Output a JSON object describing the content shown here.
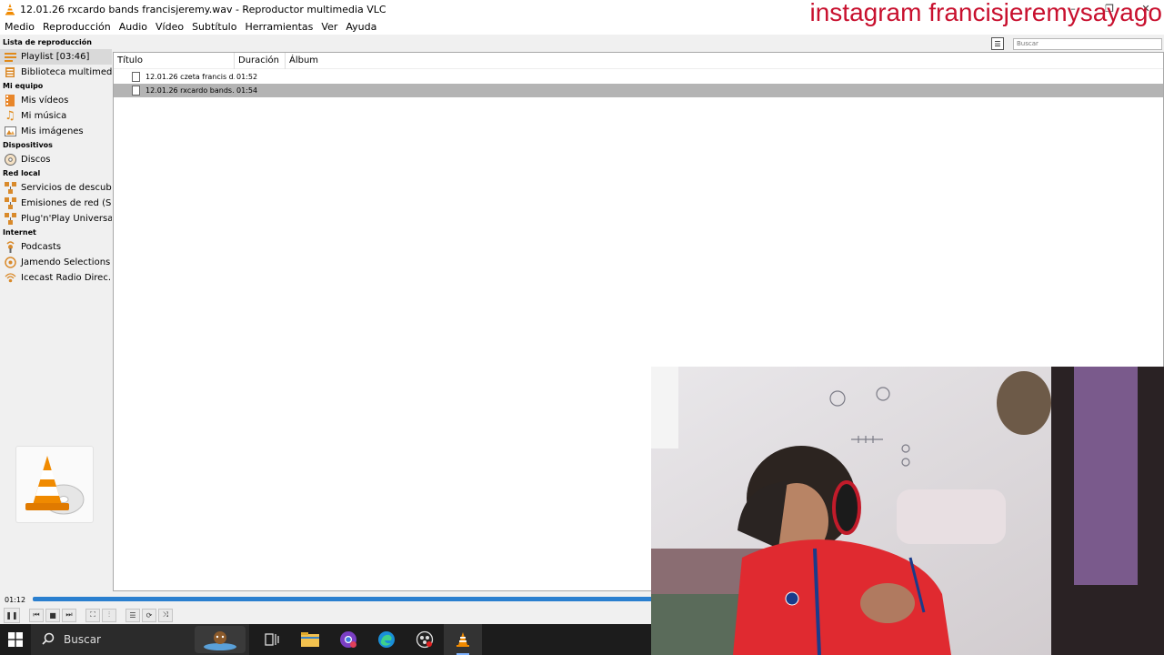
{
  "window": {
    "title": "12.01.26 rxcardo bands francisjeremy.wav - Reproductor multimedia VLC",
    "overlay": "instagram francisjeremysayago"
  },
  "menu": [
    "Medio",
    "Reproducción",
    "Audio",
    "Vídeo",
    "Subtítulo",
    "Herramientas",
    "Ver",
    "Ayuda"
  ],
  "sidebar": {
    "header": "Lista de reproducción",
    "playlist": "Playlist [03:46]",
    "media_library": "Biblioteca multimedia",
    "section_my_computer": "Mi equipo",
    "my_videos": "Mis vídeos",
    "my_music": "Mi música",
    "my_images": "Mis imágenes",
    "section_devices": "Dispositivos",
    "discs": "Discos",
    "section_local_network": "Red local",
    "discovery": "Servicios de descub...",
    "network_streams": "Emisiones de red (S...",
    "upnp": "Plug'n'Play Universal",
    "section_internet": "Internet",
    "podcasts": "Podcasts",
    "jamendo": "Jamendo Selections",
    "icecast": "Icecast Radio Direc..."
  },
  "search": {
    "placeholder": "Buscar"
  },
  "playlist": {
    "columns": {
      "title": "Título",
      "duration": "Duración",
      "album": "Álbum"
    },
    "rows": [
      {
        "title": "12.01.26 czeta francis d...",
        "duration": "01:52",
        "album": ""
      },
      {
        "title": "12.01.26 rxcardo bands...",
        "duration": "01:54",
        "album": ""
      }
    ]
  },
  "playback": {
    "elapsed": "01:12",
    "progress": 0.62
  },
  "taskbar": {
    "search": "Buscar"
  },
  "colors": {
    "accent": "#2a7fcf",
    "overlay": "#c8102e",
    "vlc_orange": "#f08a00"
  }
}
